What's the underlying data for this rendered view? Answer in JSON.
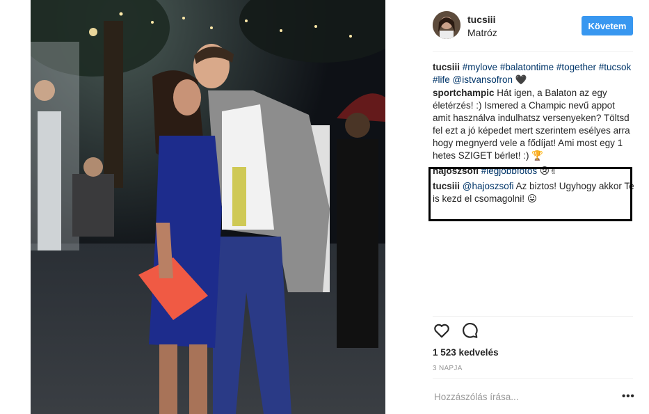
{
  "post": {
    "username": "tucsiii",
    "location": "Matróz",
    "follow_label": "Követem",
    "likes": "1 523 kedvelés",
    "time": "3 NAPJA",
    "comment_placeholder": "Hozzászólás írása...",
    "more_label": "•••"
  },
  "caption": {
    "user": "tucsiii",
    "tags": [
      "#mylove",
      "#balatontime",
      "#together",
      "#tucsok",
      "#life"
    ],
    "mention": "@istvansofron",
    "emoji": "🖤"
  },
  "comments": [
    {
      "user": "sportchampic",
      "text": "Hát igen, a Balaton az egy életérzés! :) Ismered a Champic nevű appot amit használva indulhatsz versenyeken? Töltsd fel ezt a jó képedet mert szerintem esélyes arra hogy megnyerd vele a fődíjat! Ami most egy 1 hetes SZIGET bérlet! :) ",
      "emoji": "🏆"
    },
    {
      "user": "hajoszsofi",
      "tag": "#legjobbfotos",
      "emoji": "😢✌"
    },
    {
      "user": "tucsiii",
      "mention": "@hajoszsofi",
      "text": " Az biztos! Ugyhogy akkor Te is kezd el csomagolni! ",
      "emoji": "😛"
    }
  ],
  "icons": {
    "like": "heart-outline-icon",
    "comment": "comment-bubble-icon",
    "more": "more-dots-icon"
  },
  "colors": {
    "follow_button": "#3897f0",
    "link": "#003569",
    "highlight_border": "#000000"
  }
}
